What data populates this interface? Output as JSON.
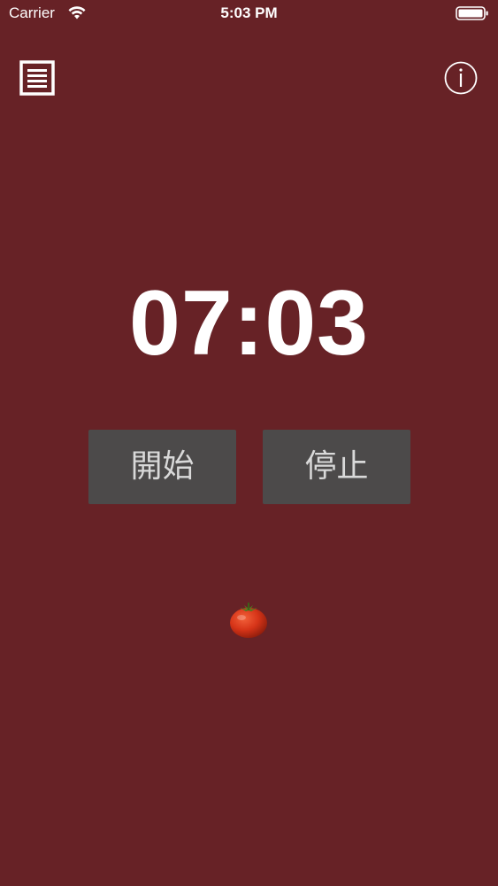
{
  "status_bar": {
    "carrier": "Carrier",
    "time": "5:03 PM",
    "wifi_icon": "wifi-icon",
    "battery_icon": "battery-icon"
  },
  "toolbar": {
    "menu_icon": "list-icon",
    "info_icon": "info-icon"
  },
  "timer": {
    "display": "07:03"
  },
  "controls": {
    "start_label": "開始",
    "stop_label": "停止"
  },
  "decoration": {
    "icon": "tomato-icon"
  },
  "colors": {
    "background": "#672226",
    "button": "#4c4a4a",
    "button_text": "#d9d9d9",
    "text": "#ffffff"
  }
}
